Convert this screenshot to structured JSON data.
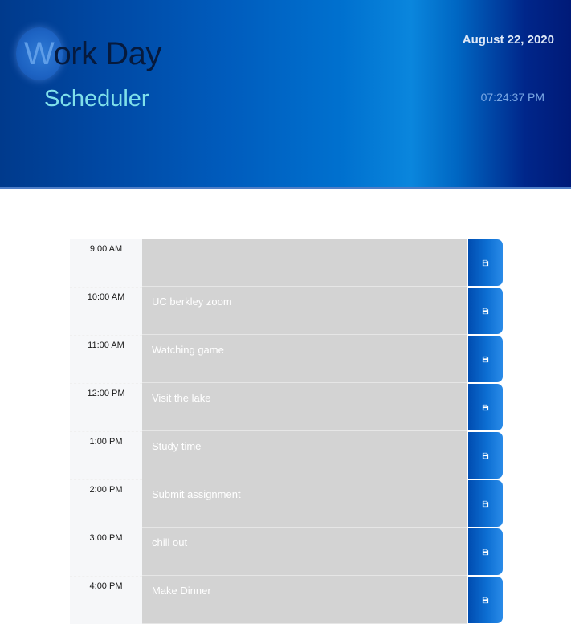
{
  "header": {
    "title_first_letter": "W",
    "title_rest": "ork Day",
    "subtitle": "Scheduler",
    "date": "August 22, 2020",
    "time": "07:24:37 PM"
  },
  "scheduler": {
    "rows": [
      {
        "hour": "9:00 AM",
        "task": ""
      },
      {
        "hour": "10:00 AM",
        "task": "UC berkley zoom"
      },
      {
        "hour": "11:00 AM",
        "task": "Watching game"
      },
      {
        "hour": "12:00 PM",
        "task": "Visit the lake"
      },
      {
        "hour": "1:00 PM",
        "task": "Study time"
      },
      {
        "hour": "2:00 PM",
        "task": "Submit assignment"
      },
      {
        "hour": "3:00 PM",
        "task": "chill out"
      },
      {
        "hour": "4:00 PM",
        "task": "Make Dinner"
      }
    ],
    "save_icon": "save-icon",
    "colors": {
      "task_bg": "#d3d3d3",
      "hour_bg": "#f6f7f9",
      "save_btn": "#0d6fd3"
    }
  }
}
